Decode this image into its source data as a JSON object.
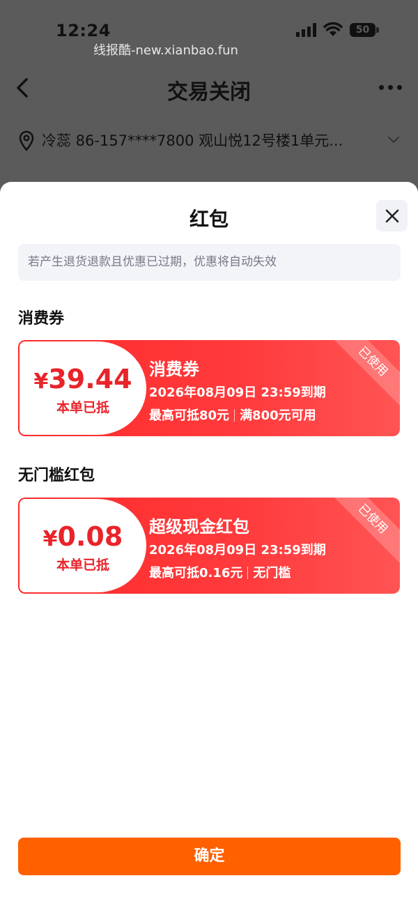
{
  "status_bar": {
    "time": "12:24",
    "battery": "50"
  },
  "watermark": "线报酷-new.xianbao.fun",
  "nav": {
    "title": "交易关闭"
  },
  "address": {
    "text": "冷蕊  86-157****7800  观山悦12号楼1单元..."
  },
  "sheet": {
    "title": "红包",
    "notice": "若产生退货退款且优惠已过期，优惠将自动失效",
    "sections": [
      {
        "title": "消费券",
        "coupon": {
          "currency": "¥",
          "amount": "39.44",
          "amount_label": "本单已抵",
          "name": "消费券",
          "expiry": "2026年08月09日  23:59到期",
          "terms": [
            "最高可抵80元",
            "满800元可用"
          ],
          "badge": "已使用"
        }
      },
      {
        "title": "无门槛红包",
        "coupon": {
          "currency": "¥",
          "amount": "0.08",
          "amount_label": "本单已抵",
          "name": "超级现金红包",
          "expiry": "2026年08月09日  23:59到期",
          "terms": [
            "最高可抵0.16元",
            "无门槛"
          ],
          "badge": "已使用"
        }
      }
    ],
    "confirm_label": "确定"
  },
  "colors": {
    "accent": "#ff6000",
    "coupon_red": "#ff2a2a",
    "amount_red": "#e8242a"
  }
}
